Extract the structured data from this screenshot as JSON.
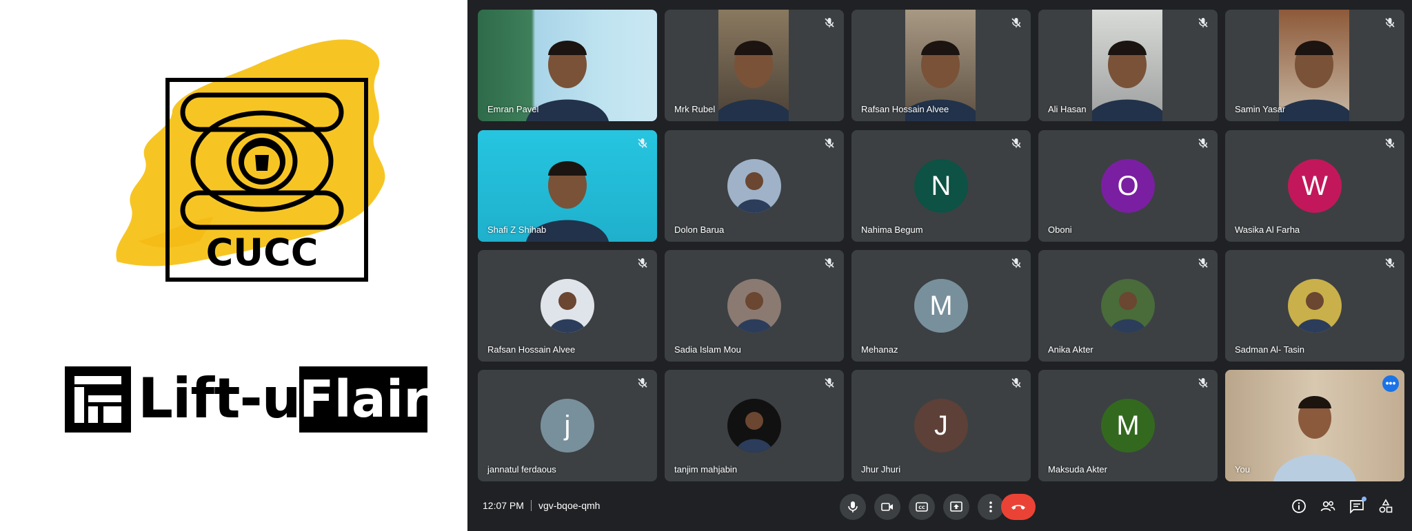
{
  "branding": {
    "cucc_text": "CUCC",
    "liftup_text": "Lift-up",
    "flair_text": "Flair"
  },
  "meeting": {
    "time": "12:07 PM",
    "code": "vgv-bqoe-qmh",
    "self_more_label": "•••"
  },
  "participants": [
    {
      "name": "Emran Pavel"
    },
    {
      "name": "Mrk Rubel"
    },
    {
      "name": "Rafsan Hossain Alvee"
    },
    {
      "name": "Ali Hasan"
    },
    {
      "name": "Samin Yasar"
    },
    {
      "name": "Shafi Z Shihab"
    },
    {
      "name": "Dolon Barua"
    },
    {
      "name": "Nahima Begum",
      "initial": "N",
      "color": "#0d5244"
    },
    {
      "name": "Oboni",
      "initial": "O",
      "color": "#7b1fa2"
    },
    {
      "name": "Wasika Al Farha",
      "initial": "W",
      "color": "#c2185b"
    },
    {
      "name": "Rafsan Hossain Alvee"
    },
    {
      "name": "Sadia Islam Mou"
    },
    {
      "name": "Mehanaz",
      "initial": "M",
      "color": "#78909c"
    },
    {
      "name": "Anika Akter"
    },
    {
      "name": "Sadman Al- Tasin"
    },
    {
      "name": "jannatul ferdaous",
      "initial": "j",
      "color": "#78909c"
    },
    {
      "name": "tanjim mahjabin"
    },
    {
      "name": "Jhur Jhuri",
      "initial": "J",
      "color": "#5d4037"
    },
    {
      "name": "Maksuda Akter",
      "initial": "M",
      "color": "#33691e"
    },
    {
      "name": "You"
    }
  ],
  "colors": {
    "tile_bg": "#3c4043",
    "meet_bg": "#202124",
    "hangup": "#ea4335",
    "accent": "#1a73e8",
    "logo_yellow": "#f7c523"
  }
}
